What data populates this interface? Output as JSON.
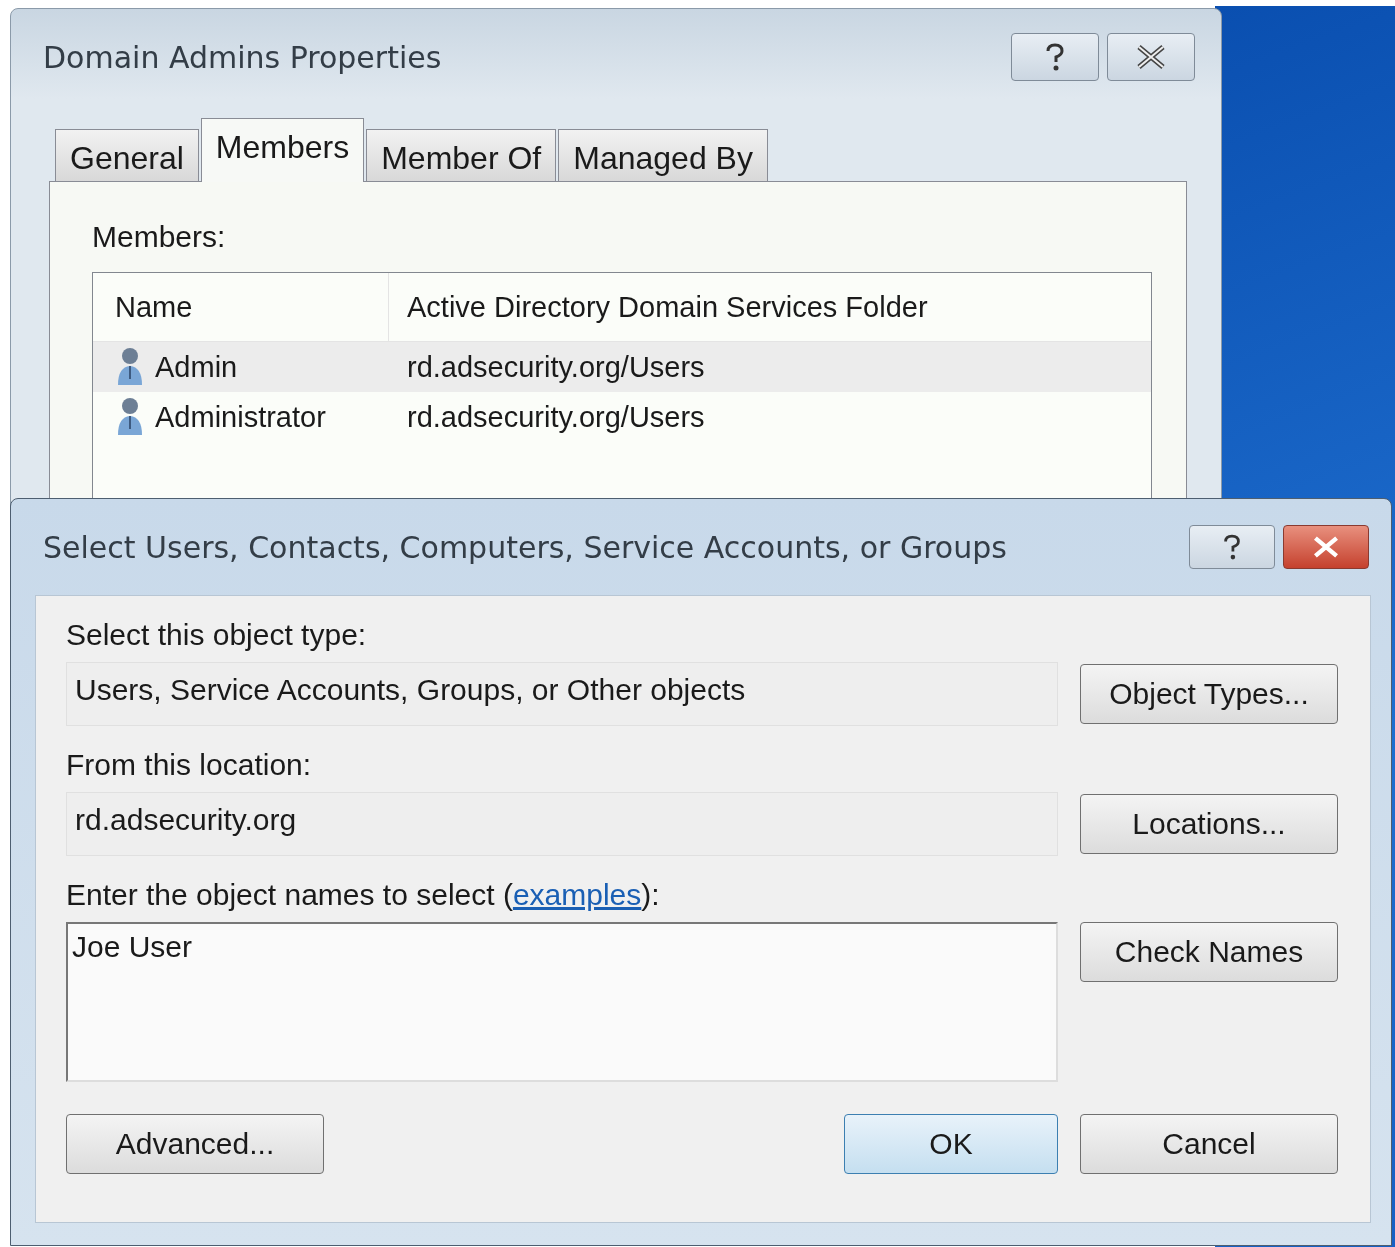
{
  "properties_window": {
    "title": "Domain Admins Properties",
    "tabs": [
      {
        "label": "General",
        "selected": false
      },
      {
        "label": "Members",
        "selected": true
      },
      {
        "label": "Member Of",
        "selected": false
      },
      {
        "label": "Managed By",
        "selected": false
      }
    ],
    "members_label": "Members:",
    "columns": [
      "Name",
      "Active Directory Domain Services Folder"
    ],
    "rows": [
      {
        "name": "Admin",
        "folder": "rd.adsecurity.org/Users",
        "selected": true
      },
      {
        "name": "Administrator",
        "folder": "rd.adsecurity.org/Users",
        "selected": false
      }
    ]
  },
  "select_dialog": {
    "title": "Select Users, Contacts, Computers, Service Accounts, or Groups",
    "object_type_label": "Select this object type:",
    "object_type_value": "Users, Service Accounts, Groups, or Other objects",
    "object_types_button": "Object Types...",
    "location_label": "From this location:",
    "location_value": "rd.adsecurity.org",
    "locations_button": "Locations...",
    "names_label_before": "Enter the object names to select (",
    "names_link": "examples",
    "names_label_after": "):",
    "names_value": "Joe User",
    "check_names_button": "Check Names",
    "advanced_button": "Advanced...",
    "ok_button": "OK",
    "cancel_button": "Cancel"
  }
}
